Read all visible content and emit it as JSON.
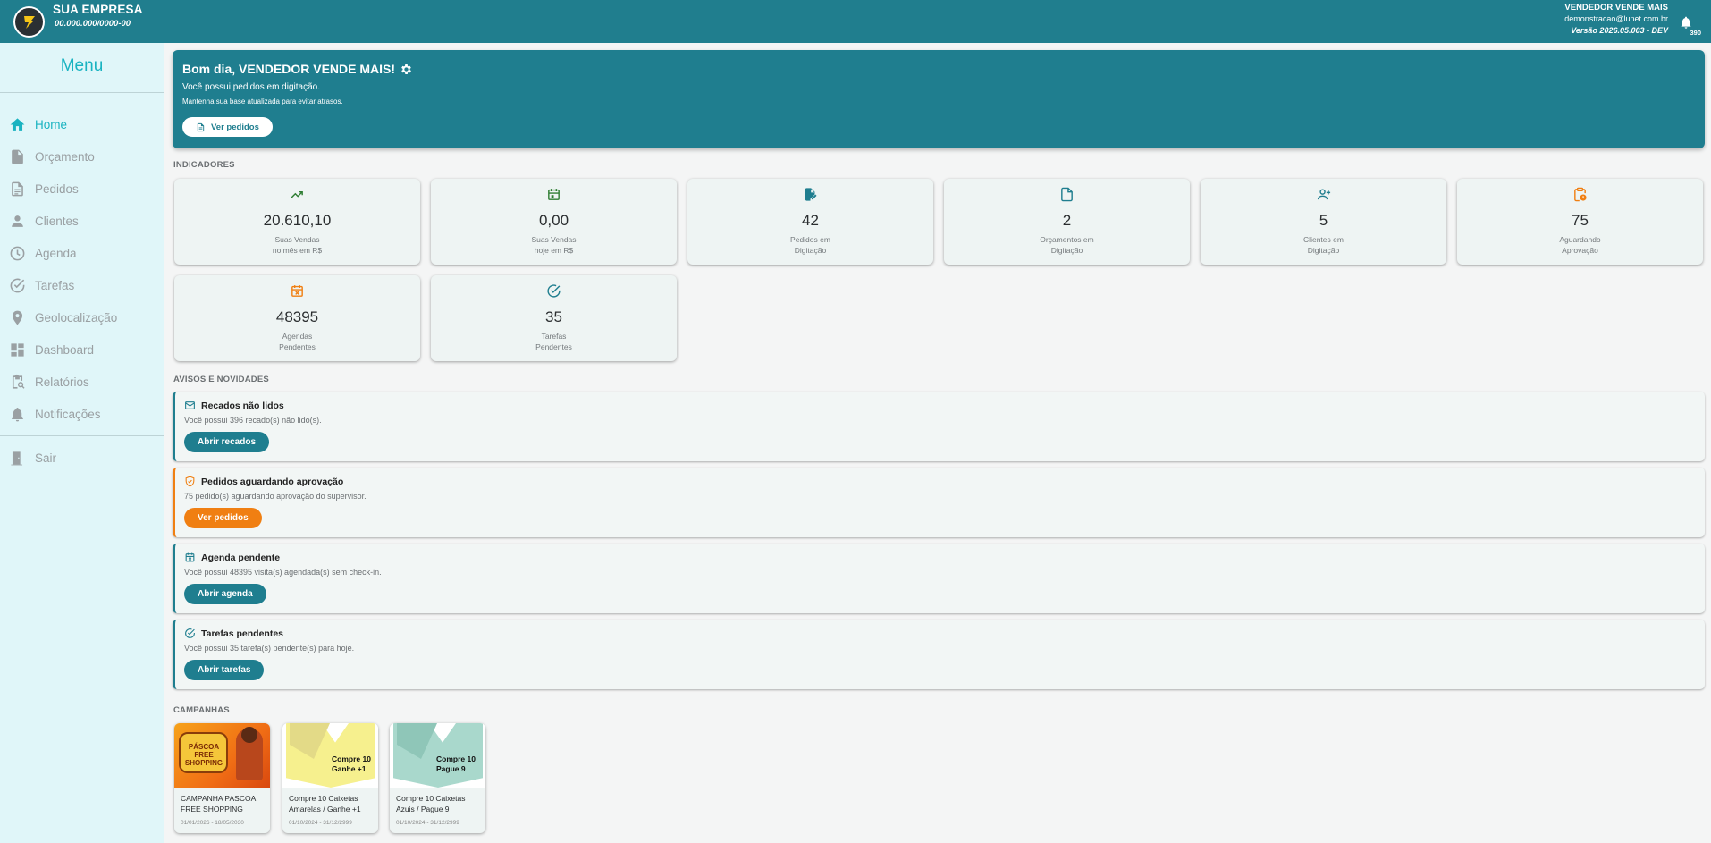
{
  "topbar": {
    "company_name": "SUA EMPRESA",
    "company_cnpj": "00.000.000/0000-00",
    "user_name": "VENDEDOR VENDE MAIS",
    "user_email": "demonstracao@lunet.com.br",
    "version": "Versão 2026.05.003 - DEV",
    "notification_count": "390"
  },
  "sidebar": {
    "title": "Menu",
    "items": [
      {
        "label": "Home",
        "icon": "home-icon"
      },
      {
        "label": "Orçamento",
        "icon": "document-icon"
      },
      {
        "label": "Pedidos",
        "icon": "list-document-icon"
      },
      {
        "label": "Clientes",
        "icon": "person-icon"
      },
      {
        "label": "Agenda",
        "icon": "clock-icon"
      },
      {
        "label": "Tarefas",
        "icon": "check-circle-icon"
      },
      {
        "label": "Geolocalização",
        "icon": "location-pin-icon"
      },
      {
        "label": "Dashboard",
        "icon": "dashboard-icon"
      },
      {
        "label": "Relatórios",
        "icon": "report-icon"
      },
      {
        "label": "Notificações",
        "icon": "bell-icon"
      }
    ],
    "logout": "Sair"
  },
  "hero": {
    "title": "Bom dia, VENDEDOR VENDE MAIS!",
    "subtitle": "Você possui pedidos em digitação.",
    "hint": "Mantenha sua base atualizada para evitar atrasos.",
    "button": "Ver pedidos"
  },
  "indicators": {
    "title": "INDICADORES",
    "cards": [
      {
        "value": "20.610,10",
        "line1": "Suas Vendas",
        "line2": "no mês em R$",
        "icon": "trending-up-icon",
        "color": "#2e7d32"
      },
      {
        "value": "0,00",
        "line1": "Suas Vendas",
        "line2": "hoje em R$",
        "icon": "calendar-icon",
        "color": "#2e7d32"
      },
      {
        "value": "42",
        "line1": "Pedidos em",
        "line2": "Digitação",
        "icon": "edit-document-icon",
        "color": "#1f7e8f"
      },
      {
        "value": "2",
        "line1": "Orçamentos em",
        "line2": "Digitação",
        "icon": "file-icon",
        "color": "#1f7e8f"
      },
      {
        "value": "5",
        "line1": "Clientes em",
        "line2": "Digitação",
        "icon": "person-add-icon",
        "color": "#1f7e8f"
      },
      {
        "value": "75",
        "line1": "Aguardando",
        "line2": "Aprovação",
        "icon": "clipboard-clock-icon",
        "color": "#f07f12"
      },
      {
        "value": "48395",
        "line1": "Agendas",
        "line2": "Pendentes",
        "icon": "calendar-x-icon",
        "color": "#f07f12"
      },
      {
        "value": "35",
        "line1": "Tarefas",
        "line2": "Pendentes",
        "icon": "check-circle-icon",
        "color": "#1f7e8f"
      }
    ]
  },
  "notices": {
    "title": "AVISOS E NOVIDADES",
    "items": [
      {
        "title": "Recados não lidos",
        "text": "Você possui 396 recado(s) não lido(s).",
        "button": "Abrir recados",
        "icon": "mail-icon"
      },
      {
        "title": "Pedidos aguardando aprovação",
        "text": "75 pedido(s) aguardando aprovação do supervisor.",
        "button": "Ver pedidos",
        "icon": "shield-check-icon"
      },
      {
        "title": "Agenda pendente",
        "text": "Você possui 48395 visita(s) agendada(s) sem check-in.",
        "button": "Abrir agenda",
        "icon": "calendar-x-icon"
      },
      {
        "title": "Tarefas pendentes",
        "text": "Você possui 35 tarefa(s) pendente(s) para hoje.",
        "button": "Abrir tarefas",
        "icon": "check-circle-icon"
      }
    ]
  },
  "campaigns": {
    "title": "CAMPANHAS",
    "items": [
      {
        "title": "CAMPANHA PASCOA FREE SHOPPING",
        "date": "01/01/2026 - 18/05/2030",
        "image_text": "PÁSCOA FREE SHOPPING"
      },
      {
        "title": "Compre 10 Caixetas Amarelas / Ganhe +1 T...",
        "date": "01/10/2024 - 31/12/2999",
        "image_text_1": "Compre 10",
        "image_text_2": "Ganhe +1"
      },
      {
        "title": "Compre 10 Caixetas Azuis / Pague 9",
        "date": "01/10/2024 - 31/12/2999",
        "image_text_1": "Compre 10",
        "image_text_2": "Pague 9"
      }
    ]
  }
}
